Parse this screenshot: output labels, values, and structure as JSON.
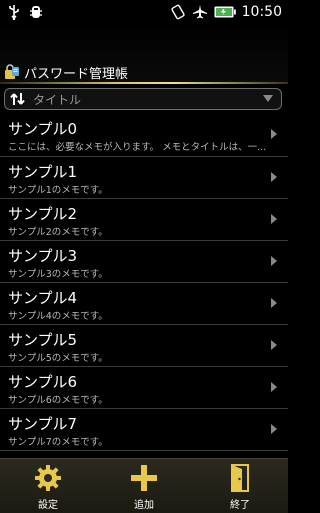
{
  "status_bar": {
    "time": "10:50",
    "icons": [
      "usb-icon",
      "usb-debug-icon",
      "rotate-lock-icon",
      "airplane-icon",
      "battery-icon"
    ]
  },
  "app": {
    "title": "パスワード管理帳",
    "icon": "lock-icon"
  },
  "sort": {
    "icon": "sort-icon",
    "label": "タイトル"
  },
  "items": [
    {
      "title": "サンプル0",
      "memo": "ここには、必要なメモが入ります。 メモとタイトルは、一..."
    },
    {
      "title": "サンプル1",
      "memo": "サンプル1のメモです。"
    },
    {
      "title": "サンプル2",
      "memo": "サンプル2のメモです。"
    },
    {
      "title": "サンプル3",
      "memo": "サンプル3のメモです。"
    },
    {
      "title": "サンプル4",
      "memo": "サンプル4のメモです。"
    },
    {
      "title": "サンプル5",
      "memo": "サンプル5のメモです。"
    },
    {
      "title": "サンプル6",
      "memo": "サンプル6のメモです。"
    },
    {
      "title": "サンプル7",
      "memo": "サンプル7のメモです。"
    }
  ],
  "bottom_bar": {
    "settings_label": "設定",
    "add_label": "追加",
    "exit_label": "終了"
  },
  "colors": {
    "accent": "#d9c46a",
    "background": "#000000",
    "battery_green": "#4caf50"
  }
}
